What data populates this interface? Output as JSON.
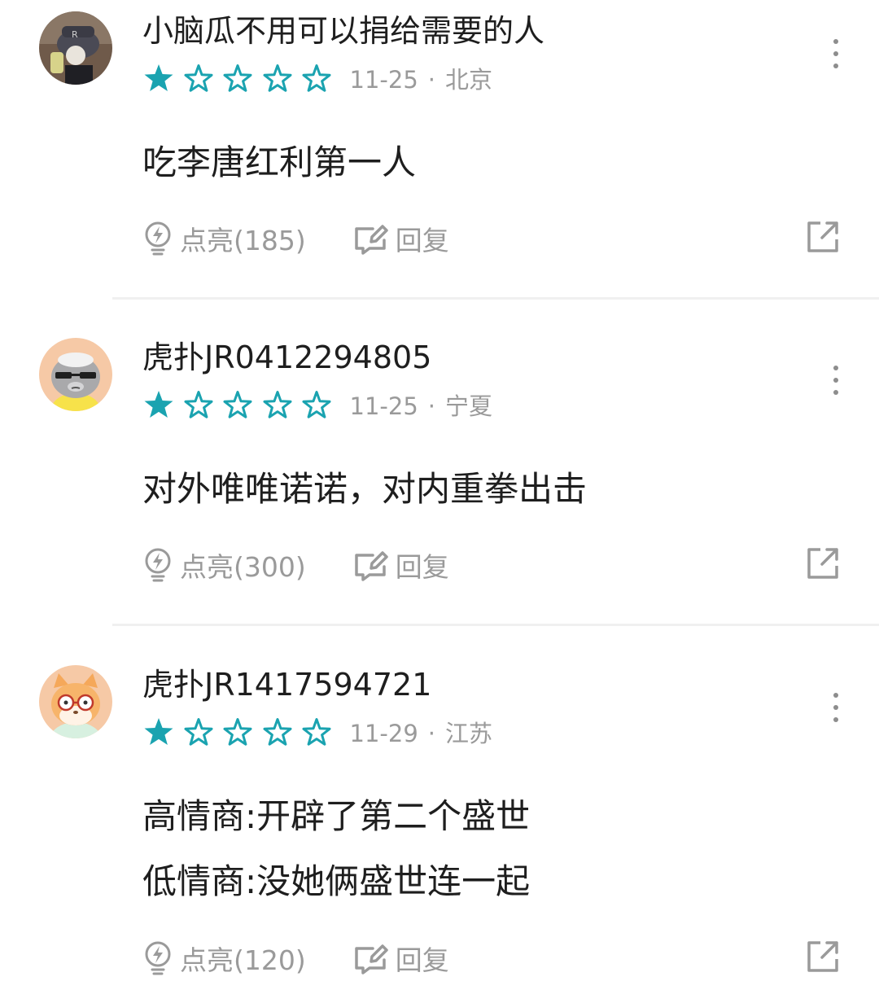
{
  "colors": {
    "accent": "#1aa3b0",
    "meta": "#9a9a9a",
    "text": "#1e1e1e",
    "divider": "#f0f0f0"
  },
  "comments": [
    {
      "username": "小脑瓜不用可以捐给需要的人",
      "rating": 1,
      "rating_max": 5,
      "date": "11-25",
      "separator": "·",
      "location": "北京",
      "content": [
        "吃李唐红利第一人"
      ],
      "like_label": "点亮(185)",
      "reply_label": "回复",
      "avatar_icon": "photo-avatar-icon"
    },
    {
      "username": "虎扑JR0412294805",
      "rating": 1,
      "rating_max": 5,
      "date": "11-25",
      "separator": "·",
      "location": "宁夏",
      "content": [
        "对外唯唯诺诺，对内重拳出击"
      ],
      "like_label": "点亮(300)",
      "reply_label": "回复",
      "avatar_icon": "cool-cat-avatar-icon"
    },
    {
      "username": "虎扑JR1417594721",
      "rating": 1,
      "rating_max": 5,
      "date": "11-29",
      "separator": "·",
      "location": "江苏",
      "content": [
        "高情商:开辟了第二个盛世",
        "低情商:没她俩盛世连一起"
      ],
      "like_label": "点亮(120)",
      "reply_label": "回复",
      "avatar_icon": "fox-glasses-avatar-icon"
    }
  ]
}
